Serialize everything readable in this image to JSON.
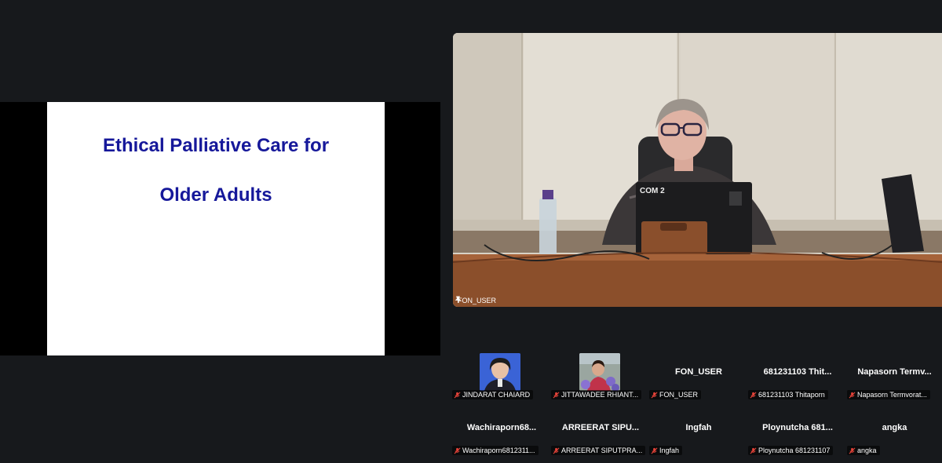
{
  "slide": {
    "line1": "Ethical Palliative Care for",
    "line2": "Older Adults"
  },
  "speaker": {
    "name": "FON_USER",
    "laptop_label": "COM 2",
    "pin_icon": "pin-icon"
  },
  "colors": {
    "background": "#17191c",
    "slide_title": "#16189a",
    "mic_muted": "#e8443a"
  },
  "participants": [
    {
      "display": "",
      "tag": "JINDARAT CHAIARD",
      "avatar": true
    },
    {
      "display": "",
      "tag": "JITTAWADEE RHIANT...",
      "avatar": true
    },
    {
      "display": "FON_USER",
      "tag": "FON_USER",
      "avatar": false
    },
    {
      "display": "681231103 Thit...",
      "tag": "681231103 Thitaporn",
      "avatar": false
    },
    {
      "display": "Napasorn Termv...",
      "tag": "Napasorn Termvorat...",
      "avatar": false
    },
    {
      "display": "Wachiraporn68...",
      "tag": "Wachiraporn6812311...",
      "avatar": false
    },
    {
      "display": "ARREERAT SIPU...",
      "tag": "ARREERAT SIPUTPRA...",
      "avatar": false
    },
    {
      "display": "Ingfah",
      "tag": "Ingfah",
      "avatar": false
    },
    {
      "display": "Ploynutcha 681...",
      "tag": "Ploynutcha 681231107",
      "avatar": false
    },
    {
      "display": "angka",
      "tag": "angka",
      "avatar": false
    }
  ]
}
